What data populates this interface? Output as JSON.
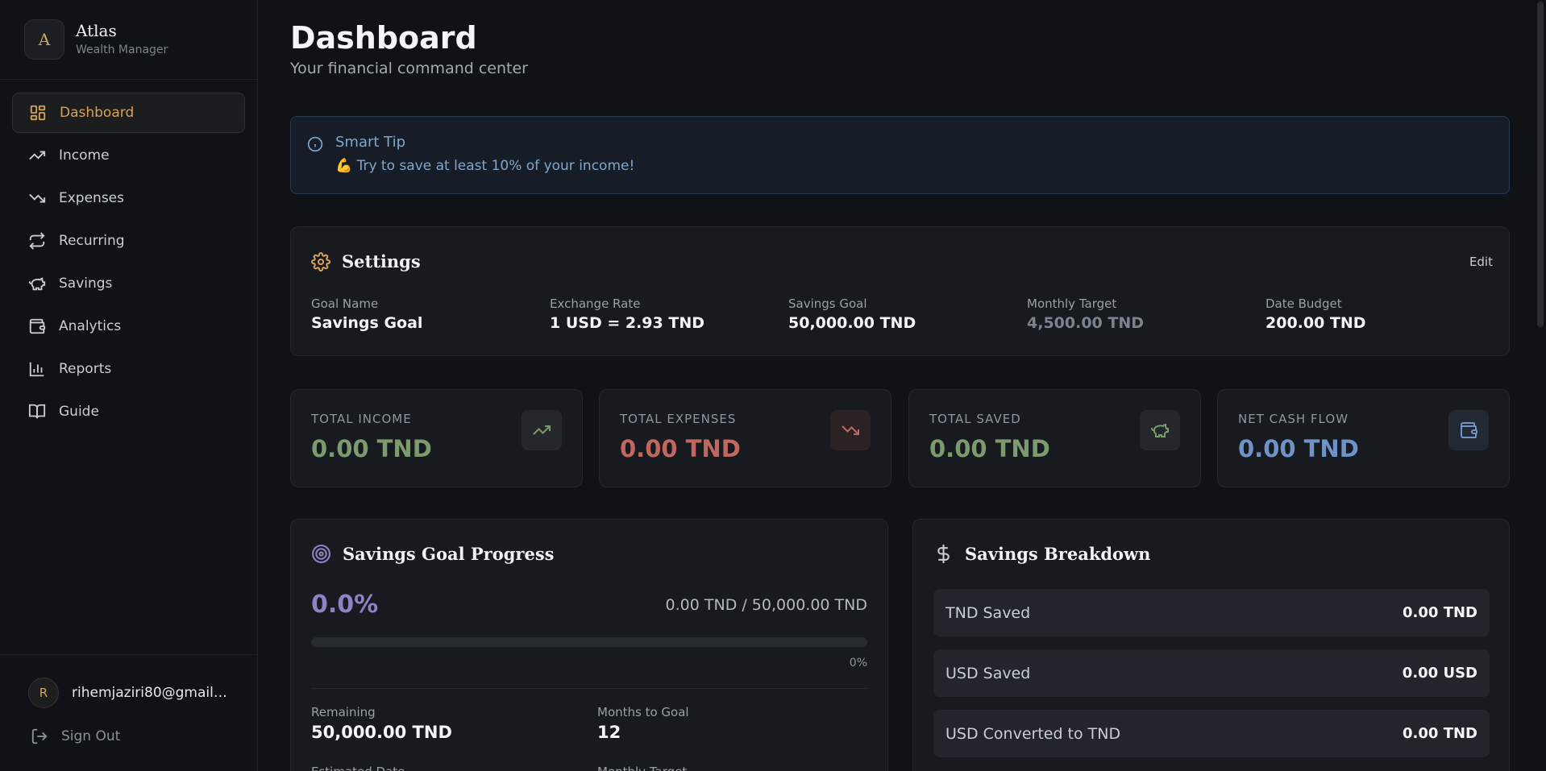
{
  "brand": {
    "logo": "A",
    "name": "Atlas",
    "subtitle": "Wealth Manager"
  },
  "nav": [
    {
      "label": "Dashboard",
      "icon": "dashboard-grid-icon",
      "active": true
    },
    {
      "label": "Income",
      "icon": "trending-up-icon"
    },
    {
      "label": "Expenses",
      "icon": "trending-down-icon"
    },
    {
      "label": "Recurring",
      "icon": "repeat-icon"
    },
    {
      "label": "Savings",
      "icon": "piggy-bank-icon"
    },
    {
      "label": "Analytics",
      "icon": "wallet-icon"
    },
    {
      "label": "Reports",
      "icon": "bar-chart-icon"
    },
    {
      "label": "Guide",
      "icon": "book-icon"
    }
  ],
  "user": {
    "initial": "R",
    "email": "rihemjaziri80@gmail.com"
  },
  "signout": "Sign Out",
  "header": {
    "title": "Dashboard",
    "subtitle": "Your financial command center"
  },
  "tip": {
    "title": "Smart Tip",
    "text": "💪 Try to save at least 10% of your income!"
  },
  "settings": {
    "title": "Settings",
    "edit": "Edit",
    "fields": [
      {
        "label": "Goal Name",
        "value": "Savings Goal"
      },
      {
        "label": "Exchange Rate",
        "value": "1 USD = 2.93 TND"
      },
      {
        "label": "Savings Goal",
        "value": "50,000.00 TND"
      },
      {
        "label": "Monthly Target",
        "value": "4,500.00 TND"
      },
      {
        "label": "Date Budget",
        "value": "200.00 TND"
      }
    ]
  },
  "stats": [
    {
      "label": "TOTAL INCOME",
      "value": "0.00 TND",
      "color": "#7d9a6e",
      "icon": "trending-up-icon"
    },
    {
      "label": "TOTAL EXPENSES",
      "value": "0.00 TND",
      "color": "#c0675f",
      "icon": "trending-down-icon"
    },
    {
      "label": "TOTAL SAVED",
      "value": "0.00 TND",
      "color": "#7d9a6e",
      "icon": "piggy-bank-icon"
    },
    {
      "label": "NET CASH FLOW",
      "value": "0.00 TND",
      "color": "#6f93c7",
      "icon": "wallet-icon"
    }
  ],
  "goal": {
    "title": "Savings Goal Progress",
    "percent": "0.0%",
    "ratio": "0.00 TND / 50,000.00 TND",
    "progress": 0,
    "bar_label": "0%",
    "remaining_label": "Remaining",
    "remaining_value": "50,000.00 TND",
    "months_label": "Months to Goal",
    "months_value": "12",
    "estimated_label": "Estimated Date",
    "monthly_label": "Monthly Target"
  },
  "breakdown": {
    "title": "Savings Breakdown",
    "rows": [
      {
        "label": "TND Saved",
        "value": "0.00 TND"
      },
      {
        "label": "USD Saved",
        "value": "0.00 USD"
      },
      {
        "label": "USD Converted to TND",
        "value": "0.00 TND"
      }
    ]
  }
}
